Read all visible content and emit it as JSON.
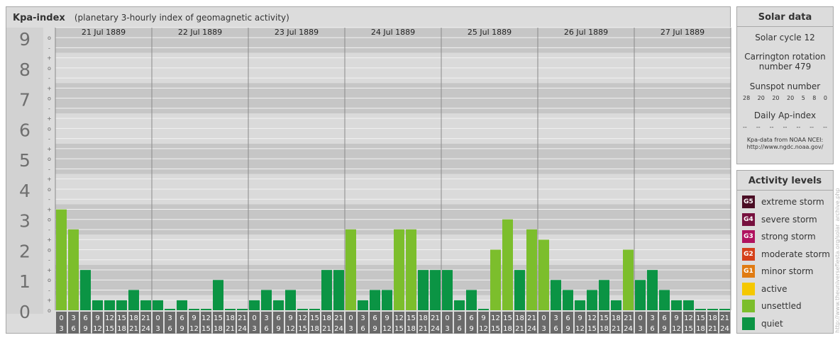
{
  "header": {
    "title": "Kpa-index",
    "subtitle": "(planetary 3-hourly index of geomagnetic activity)"
  },
  "chart_data": {
    "type": "bar",
    "y_tick_labels": [
      "0",
      "1",
      "2",
      "3",
      "4",
      "5",
      "6",
      "7",
      "8",
      "9"
    ],
    "minor_tick_labels": [
      "-",
      "o",
      "+"
    ],
    "ylim": [
      0,
      9.33
    ],
    "days": [
      "21 Jul 1889",
      "22 Jul 1889",
      "23 Jul 1889",
      "24 Jul 1889",
      "25 Jul 1889",
      "26 Jul 1889",
      "27 Jul 1889"
    ],
    "intervals": [
      [
        "0",
        "3"
      ],
      [
        "3",
        "6"
      ],
      [
        "6",
        "9"
      ],
      [
        "9",
        "12"
      ],
      [
        "12",
        "15"
      ],
      [
        "15",
        "18"
      ],
      [
        "18",
        "21"
      ],
      [
        "21",
        "24"
      ]
    ],
    "values": [
      [
        3.33,
        2.67,
        1.33,
        0.33,
        0.33,
        0.33,
        0.67,
        0.33
      ],
      [
        0.33,
        0.0,
        0.33,
        0.0,
        0.0,
        1.0,
        0.0,
        0.0
      ],
      [
        0.33,
        0.67,
        0.33,
        0.67,
        0.0,
        0.0,
        1.33,
        1.33
      ],
      [
        2.67,
        0.33,
        0.67,
        0.67,
        2.67,
        2.67,
        1.33,
        1.33
      ],
      [
        1.33,
        0.33,
        0.67,
        0.0,
        2.0,
        3.0,
        1.33,
        2.67
      ],
      [
        2.33,
        1.0,
        0.67,
        0.33,
        0.67,
        1.0,
        0.33,
        2.0
      ],
      [
        1.0,
        1.33,
        0.67,
        0.33,
        0.33,
        0.0,
        0.0,
        0.0
      ]
    ],
    "colors": {
      "quiet": "#0b9444",
      "unsettled": "#7cbe2c",
      "active": "#f5c800",
      "band_dark": "#c6c6c6",
      "band_light": "#dadada",
      "line": "#f2f2f2",
      "axis_box": "#6a6a6a"
    }
  },
  "solar": {
    "title": "Solar data",
    "cycle": "Solar cycle 12",
    "carrington_l1": "Carrington rotation",
    "carrington_l2": "number 479",
    "sunspot_title": "Sunspot number",
    "sunspots": [
      "28",
      "20",
      "20",
      "20",
      "5",
      "8",
      "0"
    ],
    "ap_title": "Daily Ap-index",
    "ap": [
      "--",
      "--",
      "--",
      "--",
      "--",
      "--",
      "--"
    ],
    "source_l1": "Kpa-data from NOAA NCEI:",
    "source_l2": "http://www.ngdc.noaa.gov/"
  },
  "activity": {
    "title": "Activity levels",
    "levels": [
      {
        "badge": "G5",
        "label": "extreme storm",
        "color": "#4a0d24"
      },
      {
        "badge": "G4",
        "label": "severe storm",
        "color": "#76103e"
      },
      {
        "badge": "G3",
        "label": "strong storm",
        "color": "#b0125f"
      },
      {
        "badge": "G2",
        "label": "moderate storm",
        "color": "#d5401a"
      },
      {
        "badge": "G1",
        "label": "minor storm",
        "color": "#e07b12"
      },
      {
        "badge": "",
        "label": "active",
        "color": "#f5c800"
      },
      {
        "badge": "",
        "label": "unsettled",
        "color": "#7cbe2c"
      },
      {
        "badge": "",
        "label": "quiet",
        "color": "#0b9444"
      }
    ]
  },
  "watermark": "http://www.theuniversefiesta.org/solar_archive.php"
}
